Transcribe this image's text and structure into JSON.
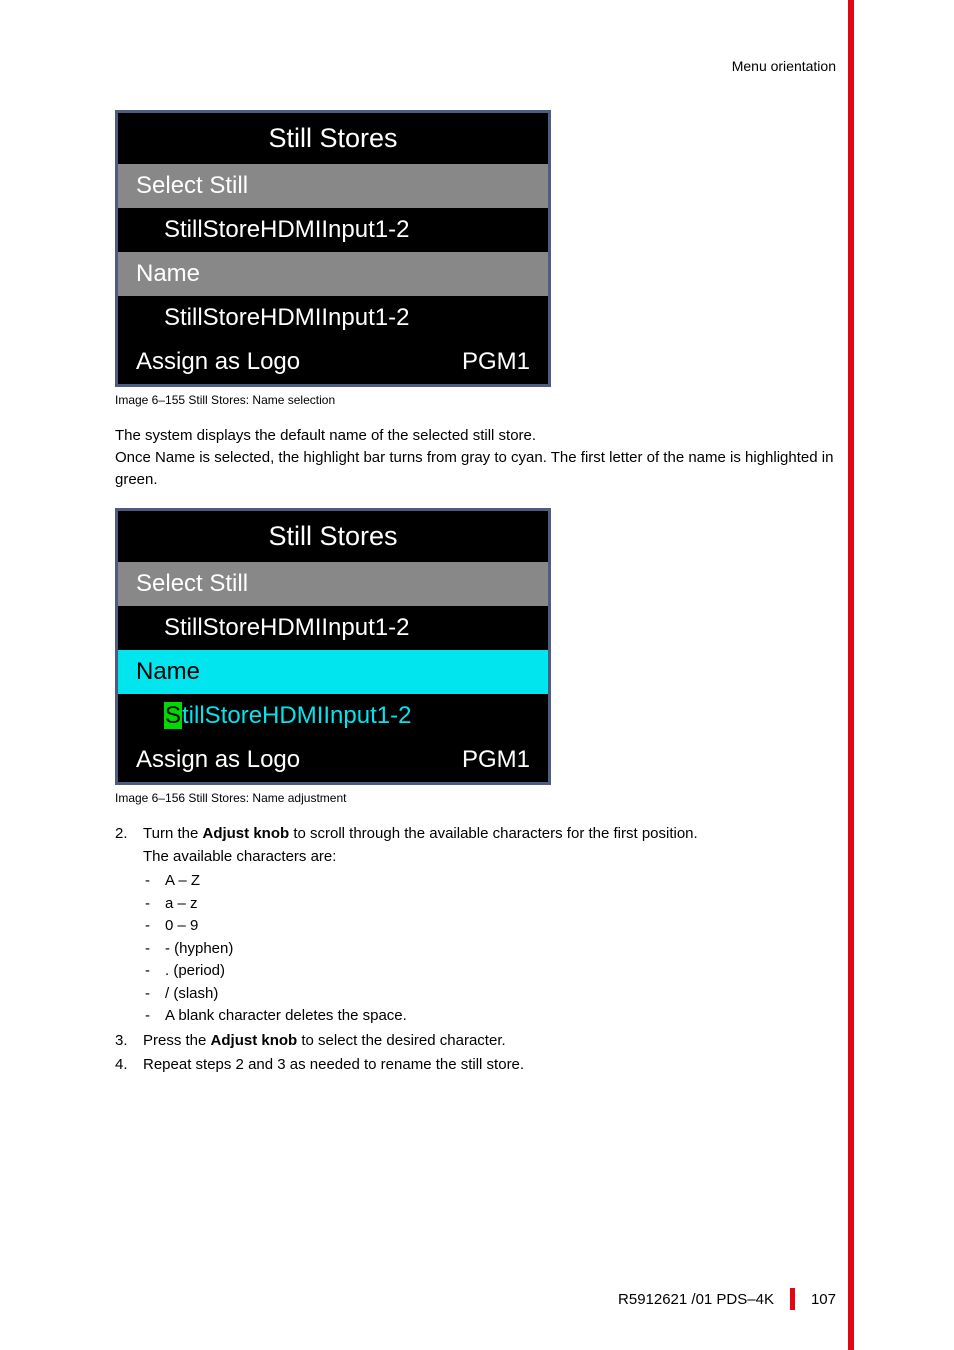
{
  "header": "Menu orientation",
  "img1": {
    "title": "Still Stores",
    "selectStill": "Select Still",
    "selectStillVal": "StillStoreHDMIInput1-2",
    "name": "Name",
    "nameVal": "StillStoreHDMIInput1-2",
    "assignLogo": "Assign as Logo",
    "pgm": "PGM1",
    "caption": "Image 6–155  Still Stores: Name selection"
  },
  "para1a": "The system displays the default name of the selected still store.",
  "para1b": "Once Name is selected, the highlight bar turns from gray to cyan. The first letter of the name is highlighted in green.",
  "img2": {
    "title": "Still Stores",
    "selectStill": "Select Still",
    "selectStillVal": "StillStoreHDMIInput1-2",
    "name": "Name",
    "nameFirst": "S",
    "nameRest": "tillStoreHDMIInput1-2",
    "assignLogo": "Assign as Logo",
    "pgm": "PGM1",
    "caption": "Image 6–156  Still Stores: Name adjustment"
  },
  "step2": {
    "num": "2.",
    "textA": "Turn the ",
    "textBold": "Adjust knob",
    "textB": " to scroll through the available characters for the first position.",
    "textC": "The available characters are:",
    "chars": [
      "A – Z",
      "a – z",
      "0 – 9",
      "- (hyphen)",
      ". (period)",
      "/ (slash)",
      "A blank character deletes the space."
    ]
  },
  "step3": {
    "num": "3.",
    "textA": "Press the ",
    "textBold": "Adjust knob",
    "textB": " to select the desired character."
  },
  "step4": {
    "num": "4.",
    "text": "Repeat steps 2 and 3 as needed to rename the still store."
  },
  "footer": {
    "docRef": "R5912621 /01 PDS–4K",
    "pageNum": "107"
  }
}
